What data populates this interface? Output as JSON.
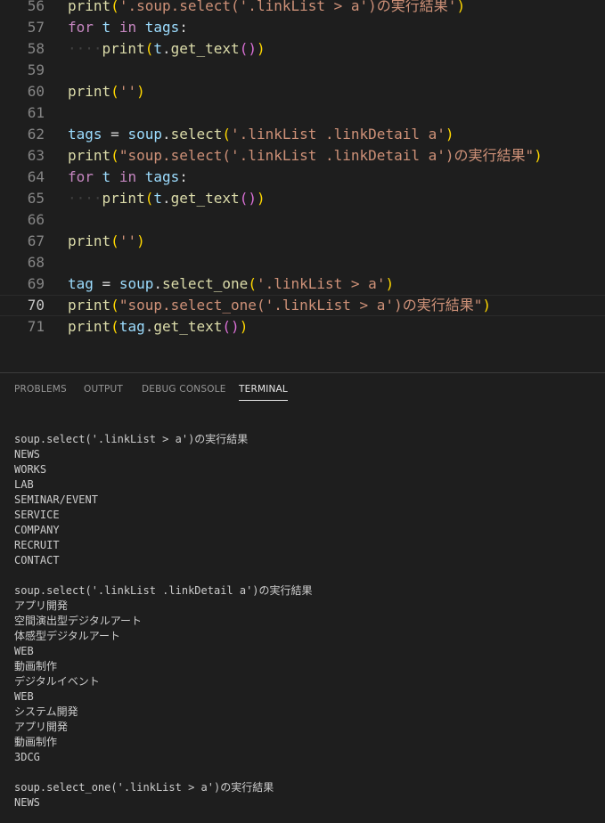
{
  "editor": {
    "lines": [
      {
        "num": "56",
        "tokens": [
          [
            "fn",
            "print"
          ],
          [
            "p1",
            "("
          ],
          [
            "str",
            "'.soup.select('.linkList > a')の実行結果'"
          ],
          [
            "p1",
            ")"
          ]
        ]
      },
      {
        "num": "57",
        "tokens": [
          [
            "kw",
            "for"
          ],
          [
            "pl",
            " "
          ],
          [
            "var",
            "t"
          ],
          [
            "pl",
            " "
          ],
          [
            "kw",
            "in"
          ],
          [
            "pl",
            " "
          ],
          [
            "var",
            "tags"
          ],
          [
            "pl",
            ":"
          ]
        ]
      },
      {
        "num": "58",
        "tokens": [
          [
            "ws",
            "····"
          ],
          [
            "fn",
            "print"
          ],
          [
            "p1",
            "("
          ],
          [
            "var",
            "t"
          ],
          [
            "pl",
            "."
          ],
          [
            "fn",
            "get_text"
          ],
          [
            "p2",
            "()"
          ],
          [
            "p1",
            ")"
          ]
        ]
      },
      {
        "num": "59",
        "tokens": []
      },
      {
        "num": "60",
        "tokens": [
          [
            "fn",
            "print"
          ],
          [
            "p1",
            "("
          ],
          [
            "str",
            "''"
          ],
          [
            "p1",
            ")"
          ]
        ]
      },
      {
        "num": "61",
        "tokens": []
      },
      {
        "num": "62",
        "tokens": [
          [
            "var",
            "tags"
          ],
          [
            "pl",
            " = "
          ],
          [
            "var",
            "soup"
          ],
          [
            "pl",
            "."
          ],
          [
            "fn",
            "select"
          ],
          [
            "p1",
            "("
          ],
          [
            "str",
            "'.linkList .linkDetail a'"
          ],
          [
            "p1",
            ")"
          ]
        ]
      },
      {
        "num": "63",
        "tokens": [
          [
            "fn",
            "print"
          ],
          [
            "p1",
            "("
          ],
          [
            "str",
            "\"soup.select('.linkList .linkDetail a')の実行結果\""
          ],
          [
            "p1",
            ")"
          ]
        ]
      },
      {
        "num": "64",
        "tokens": [
          [
            "kw",
            "for"
          ],
          [
            "pl",
            " "
          ],
          [
            "var",
            "t"
          ],
          [
            "pl",
            " "
          ],
          [
            "kw",
            "in"
          ],
          [
            "pl",
            " "
          ],
          [
            "var",
            "tags"
          ],
          [
            "pl",
            ":"
          ]
        ]
      },
      {
        "num": "65",
        "tokens": [
          [
            "ws",
            "····"
          ],
          [
            "fn",
            "print"
          ],
          [
            "p1",
            "("
          ],
          [
            "var",
            "t"
          ],
          [
            "pl",
            "."
          ],
          [
            "fn",
            "get_text"
          ],
          [
            "p2",
            "()"
          ],
          [
            "p1",
            ")"
          ]
        ]
      },
      {
        "num": "66",
        "tokens": []
      },
      {
        "num": "67",
        "tokens": [
          [
            "fn",
            "print"
          ],
          [
            "p1",
            "("
          ],
          [
            "str",
            "''"
          ],
          [
            "p1",
            ")"
          ]
        ]
      },
      {
        "num": "68",
        "tokens": []
      },
      {
        "num": "69",
        "tokens": [
          [
            "var",
            "tag"
          ],
          [
            "pl",
            " = "
          ],
          [
            "var",
            "soup"
          ],
          [
            "pl",
            "."
          ],
          [
            "fn",
            "select_one"
          ],
          [
            "p1",
            "("
          ],
          [
            "str",
            "'.linkList > a'"
          ],
          [
            "p1",
            ")"
          ]
        ]
      },
      {
        "num": "70",
        "tokens": [
          [
            "fn",
            "print"
          ],
          [
            "p1",
            "("
          ],
          [
            "str",
            "\"soup.select_one('.linkList > a')の実行結果\""
          ],
          [
            "p1",
            ")"
          ]
        ],
        "current": true
      },
      {
        "num": "71",
        "tokens": [
          [
            "fn",
            "print"
          ],
          [
            "p1",
            "("
          ],
          [
            "var",
            "tag"
          ],
          [
            "pl",
            "."
          ],
          [
            "fn",
            "get_text"
          ],
          [
            "p2",
            "()"
          ],
          [
            "p1",
            ")"
          ]
        ]
      }
    ]
  },
  "panel": {
    "tabs": [
      {
        "label": "PROBLEMS",
        "active": false
      },
      {
        "label": "OUTPUT",
        "active": false
      },
      {
        "label": "DEBUG CONSOLE",
        "active": false
      },
      {
        "label": "TERMINAL",
        "active": true
      }
    ]
  },
  "terminal": {
    "lines": [
      "soup.select('.linkList > a')の実行結果",
      "NEWS",
      "WORKS",
      "LAB",
      "SEMINAR/EVENT",
      "SERVICE",
      "COMPANY",
      "RECRUIT",
      "CONTACT",
      "",
      "soup.select('.linkList .linkDetail a')の実行結果",
      "アプリ開発",
      "空間演出型デジタルアート",
      "体感型デジタルアート",
      "WEB",
      "動画制作",
      "デジタルイベント",
      "WEB",
      "システム開発",
      "アプリ開発",
      "動画制作",
      "3DCG",
      "",
      "soup.select_one('.linkList > a')の実行結果",
      "NEWS"
    ]
  }
}
